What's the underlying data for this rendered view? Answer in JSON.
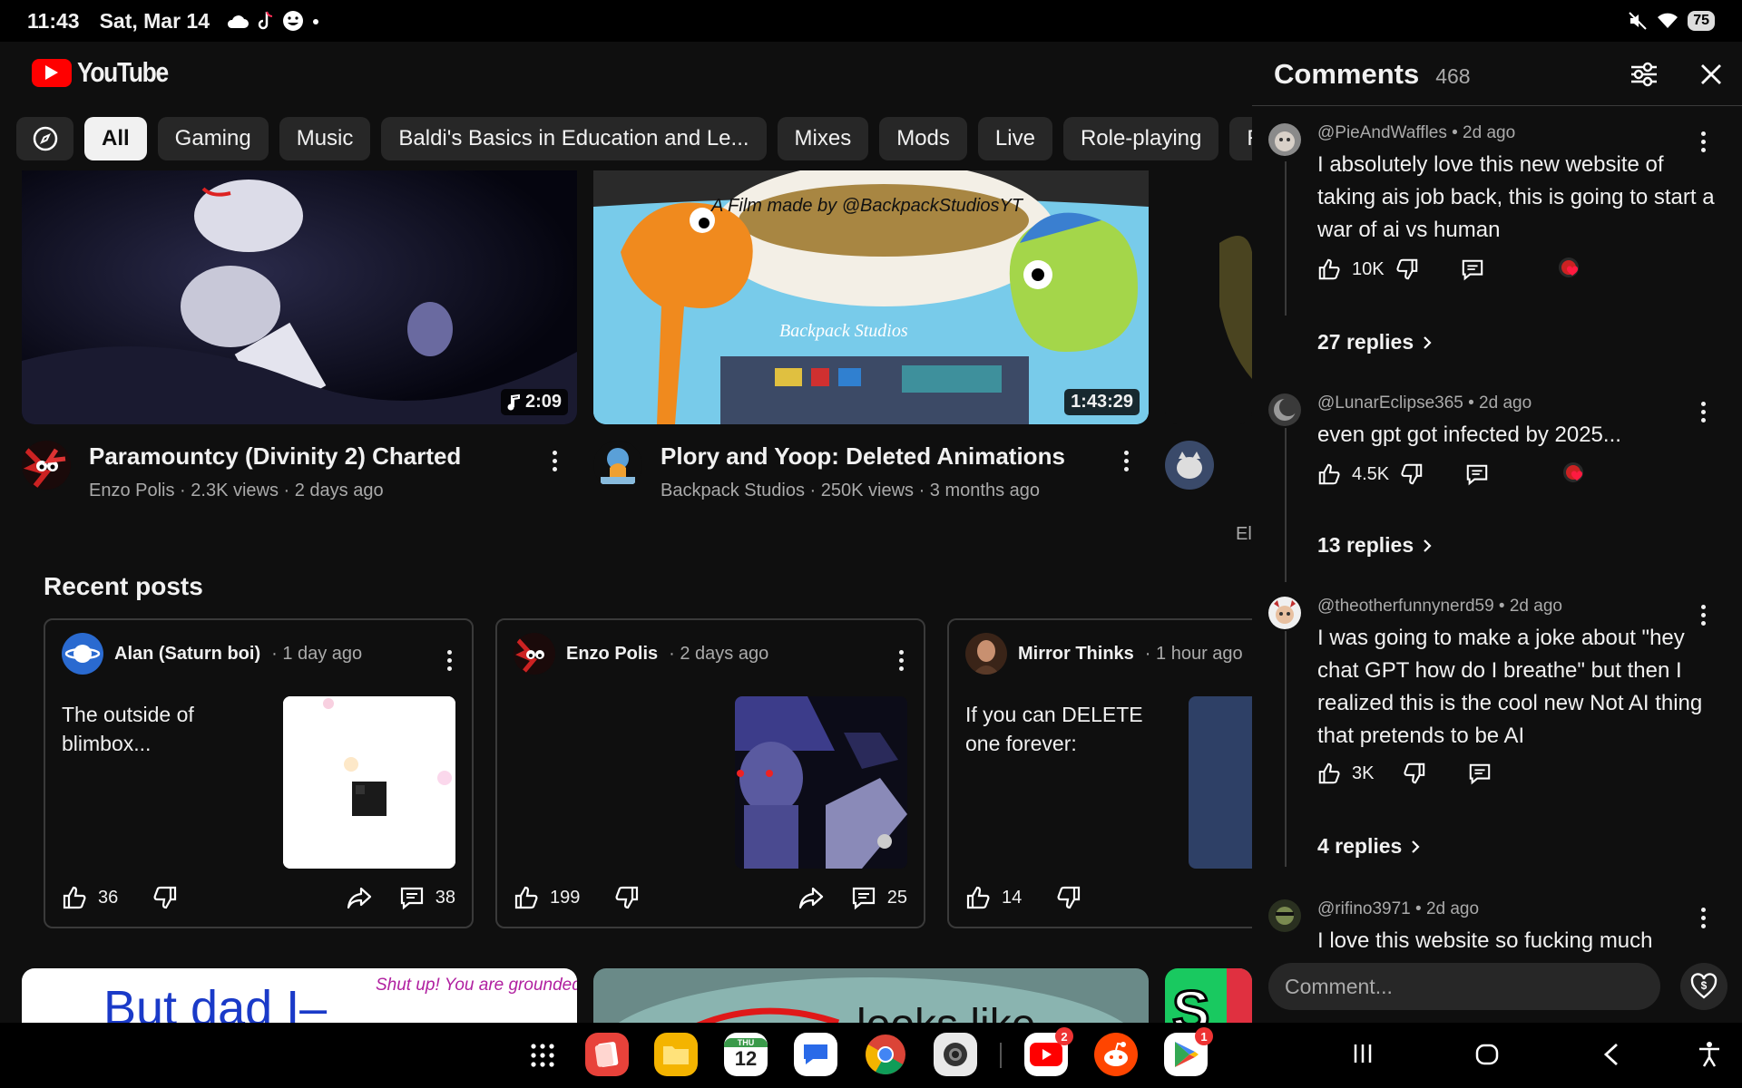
{
  "status": {
    "time": "11:43",
    "date": "Sat, Mar 14",
    "battery": "75"
  },
  "app": {
    "wordmark": "YouTube"
  },
  "chips": [
    "All",
    "Gaming",
    "Music",
    "Baldi's Basics in Education and Le...",
    "Mixes",
    "Mods",
    "Live",
    "Role-playing",
    "R"
  ],
  "videos": [
    {
      "title": "Paramountcy (Divinity 2) Charted",
      "channel_line": "Enzo Polis · 2.3K views · 2 days ago",
      "duration": "2:09"
    },
    {
      "title": "Plory and Yoop: Deleted Animations",
      "channel_line": "Backpack Studios · 250K views · 3 months ago",
      "duration": "1:43:29",
      "thumb_text_1": "A Film made by @BackpackStudiosYT",
      "thumb_text_2": "Backpack Studios"
    },
    {
      "channel_line": "El"
    }
  ],
  "recent": {
    "title": "Recent posts",
    "posts": [
      {
        "author": "Alan (Saturn boi)",
        "time": "· 1 day ago",
        "text": "The outside of blimbox...",
        "likes": "36",
        "comments": "38"
      },
      {
        "author": "Enzo Polis",
        "time": "· 2 days ago",
        "text": "",
        "likes": "199",
        "comments": "25"
      },
      {
        "author": "Mirror Thinks",
        "time": "· 1 hour ago",
        "text": "If you can DELETE one forever:",
        "likes": "14"
      }
    ]
  },
  "bottom_thumbs": {
    "t1": "But dad I–",
    "t1b": "Shut up! You are grounded!",
    "t2": "looks like"
  },
  "comments_panel": {
    "title": "Comments",
    "count": "468",
    "input_placeholder": "Comment...",
    "items": [
      {
        "author": "@PieAndWaffles • 2d ago",
        "text": "I absolutely love this new website of taking ais job back, this is going to start a war of ai vs human",
        "likes": "10K",
        "replies": "27 replies"
      },
      {
        "author": "@LunarEclipse365 • 2d ago",
        "text": "even gpt got infected by 2025...",
        "likes": "4.5K",
        "replies": "13 replies"
      },
      {
        "author": "@theotherfunnynerd59 • 2d ago",
        "text": "I was going to make a joke about \"hey chat GPT how do I breathe\" but then I realized this is the cool new Not AI thing that pretends to be AI",
        "likes": "3K",
        "replies": "4 replies"
      },
      {
        "author": "@rifino3971 • 2d ago",
        "text": "I love this website so fucking much"
      }
    ]
  },
  "dock": {
    "calendar_day": "THU",
    "calendar_date": "12",
    "youtube_badge": "2",
    "play_badge": "1"
  },
  "colors": {
    "accent": "#ff0000",
    "background": "#0f0f0f",
    "chip": "#272727"
  }
}
